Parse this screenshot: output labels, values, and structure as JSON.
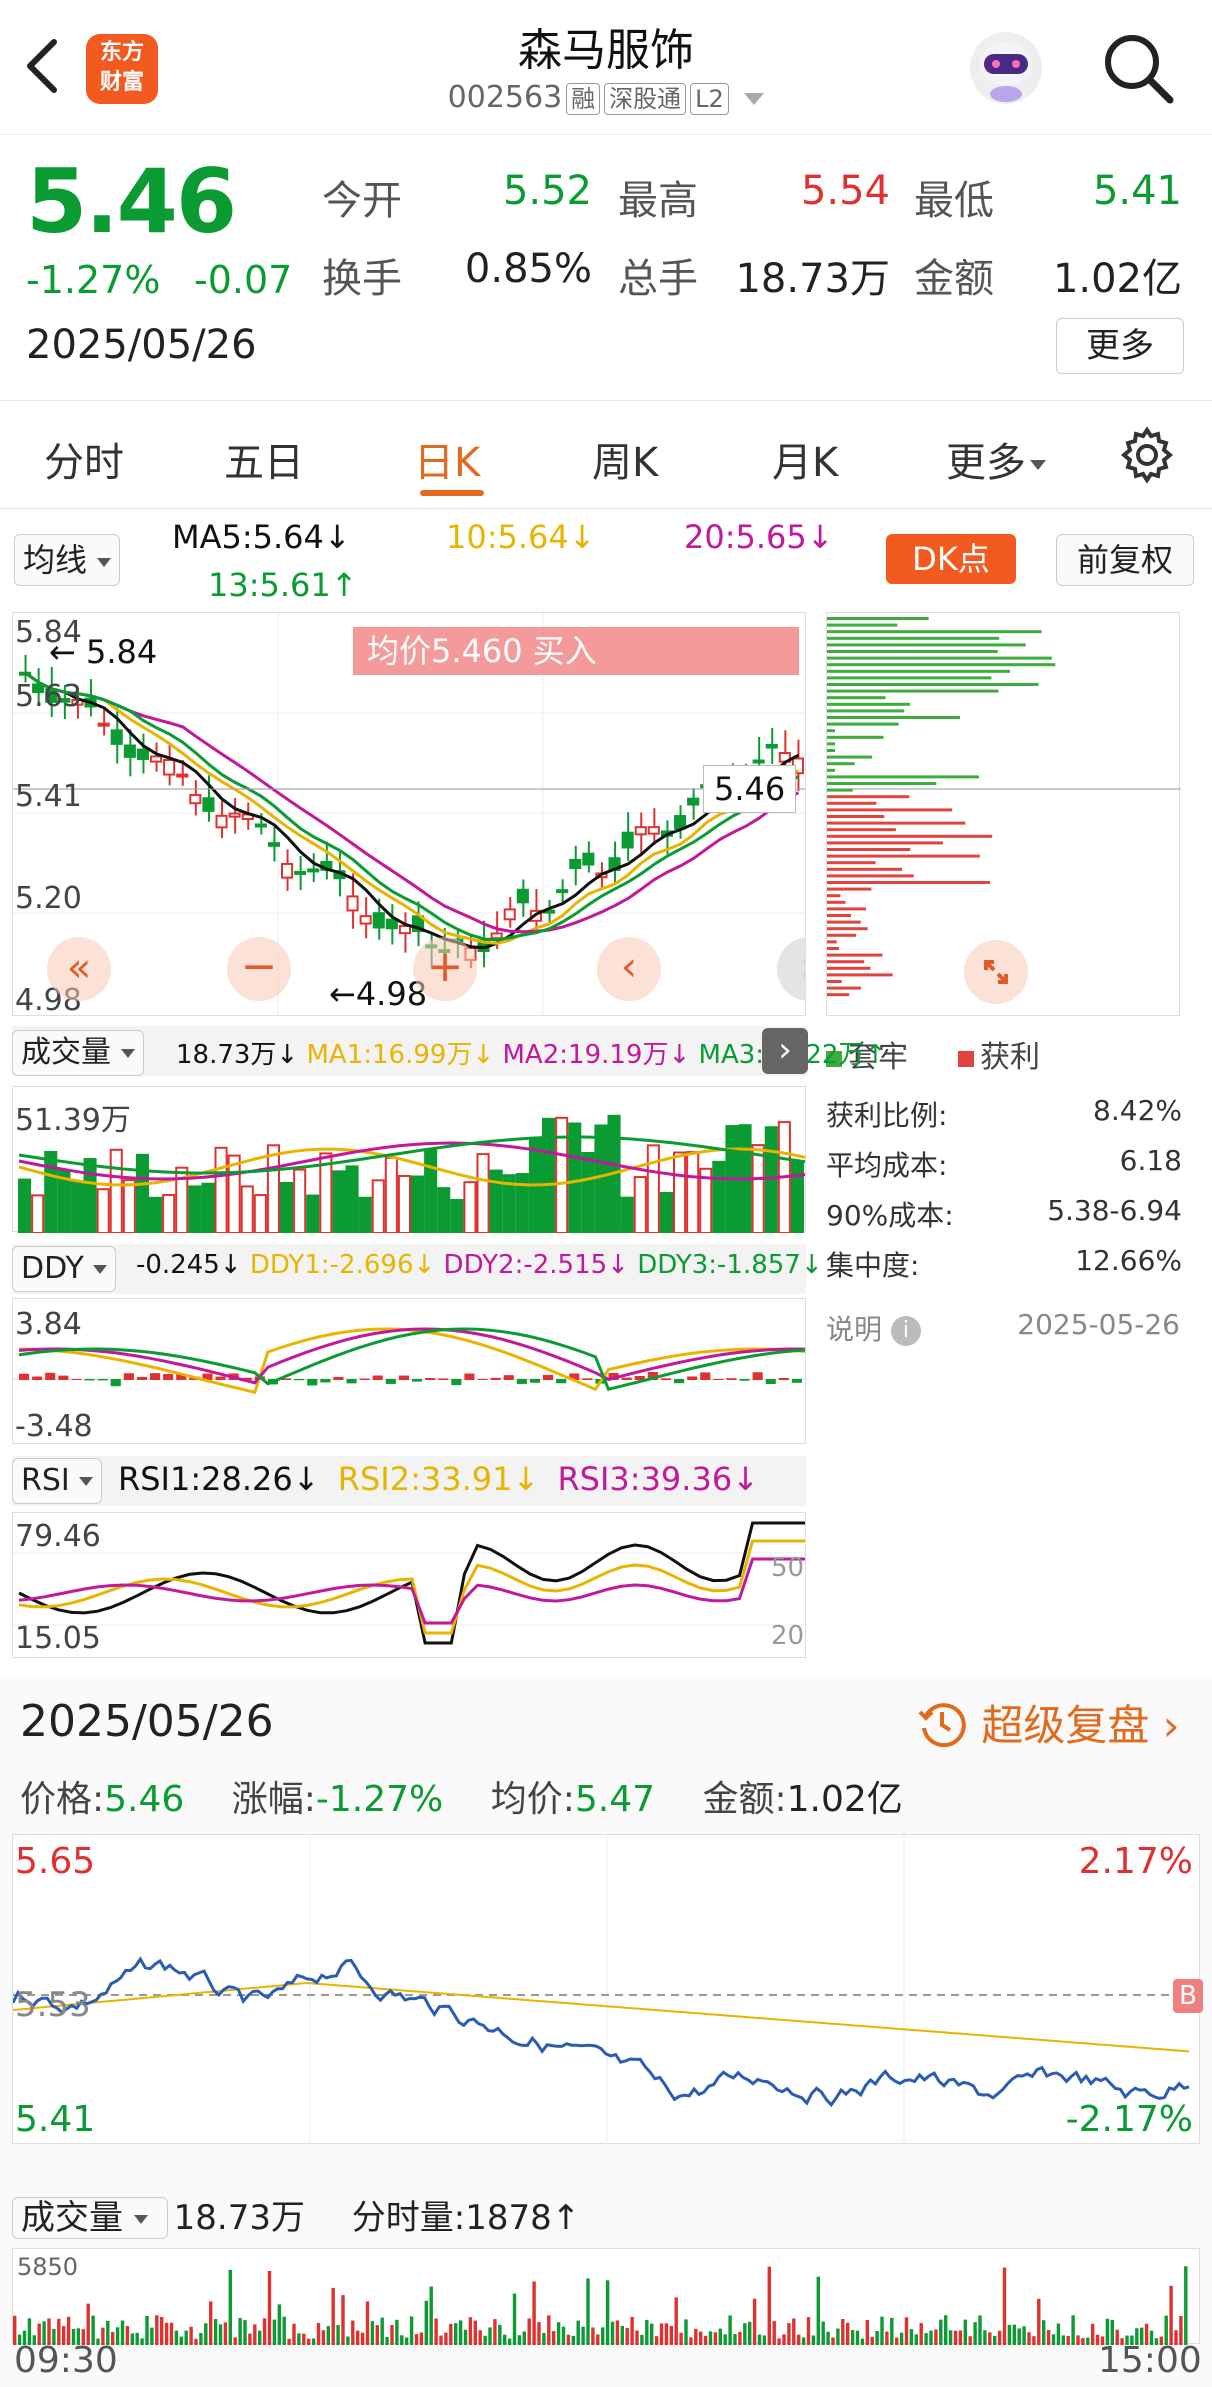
{
  "header": {
    "stock_name": "森马服饰",
    "stock_code": "002563",
    "tags": [
      "融",
      "深股通",
      "L2"
    ],
    "logo_line1": "东方",
    "logo_line2": "财富"
  },
  "quote": {
    "price": "5.46",
    "change_pct": "-1.27%",
    "change": "-0.07",
    "date": "2025/05/26",
    "open_label": "今开",
    "open": "5.52",
    "high_label": "最高",
    "high": "5.54",
    "low_label": "最低",
    "low": "5.41",
    "turnover_label": "换手",
    "turnover": "0.85%",
    "volume_label": "总手",
    "volume": "18.73万",
    "amount_label": "金额",
    "amount": "1.02亿",
    "more_button": "更多"
  },
  "tabs": [
    {
      "label": "分时"
    },
    {
      "label": "五日"
    },
    {
      "label": "日K"
    },
    {
      "label": "周K"
    },
    {
      "label": "月K"
    },
    {
      "label": "更多"
    }
  ],
  "kline": {
    "ma_selector": "均线",
    "ma5": "MA5:5.64↓",
    "ma10": "10:5.64↓",
    "ma20": "20:5.65↓",
    "ma13": "13:5.61↑",
    "dk_button": "DK点",
    "restore_button": "前复权",
    "y_labels": [
      "5.84",
      "5.63",
      "5.41",
      "5.20",
      "4.98"
    ],
    "high_marker": "5.84",
    "low_marker": "4.98",
    "current_marker": "5.46",
    "avg_price_banner": "均价5.460  买入",
    "chip_legend_trapped": "套牢",
    "chip_legend_profit": "获利",
    "chip_stats": [
      {
        "label": "获利比例:",
        "value": "8.42%"
      },
      {
        "label": "平均成本:",
        "value": "6.18"
      },
      {
        "label": "90%成本:",
        "value": "5.38-6.94"
      },
      {
        "label": "集中度:",
        "value": "12.66%"
      }
    ],
    "chip_note": "说明",
    "chip_date": "2025-05-26"
  },
  "volume_panel": {
    "selector": "成交量",
    "value": "18.73万↓",
    "ma1": "MA1:16.99万↓",
    "ma2": "MA2:19.19万↓",
    "ma3": "MA3:22.22万↑",
    "max_label": "51.39万"
  },
  "ddy_panel": {
    "selector": "DDY",
    "value": "-0.245↓",
    "ddy1": "DDY1:-2.696↓",
    "ddy2": "DDY2:-2.515↓",
    "ddy3": "DDY3:-1.857↓",
    "top_label": "3.84",
    "bottom_label": "-3.48"
  },
  "rsi_panel": {
    "selector": "RSI",
    "rsi1": "RSI1:28.26↓",
    "rsi2": "RSI2:33.91↓",
    "rsi3": "RSI3:39.36↓",
    "top_label": "79.46",
    "bottom_label": "15.05",
    "ref50": "50",
    "ref20": "20"
  },
  "intraday": {
    "date": "2025/05/26",
    "replay_button": "超级复盘",
    "price_label": "价格:",
    "price": "5.46",
    "change_label": "涨幅:",
    "change": "-1.27%",
    "avg_label": "均价:",
    "avg": "5.47",
    "amount_label": "金额:",
    "amount": "1.02亿",
    "y_top": "5.65",
    "y_mid": "5.53",
    "y_bottom": "5.41",
    "pct_top": "2.17%",
    "pct_bottom": "-2.17%",
    "volume_selector": "成交量",
    "volume_total": "18.73万",
    "minute_volume": "分时量:1878↑",
    "volume_max": "5850",
    "time_start": "09:30",
    "time_end": "15:00"
  },
  "colors": {
    "up": "#e03131",
    "down": "#0a9b32",
    "accent": "#e36a1c",
    "ma5": "#111111",
    "ma10": "#e8b400",
    "ma20": "#c2189a",
    "ma13": "#0a9b32"
  }
}
